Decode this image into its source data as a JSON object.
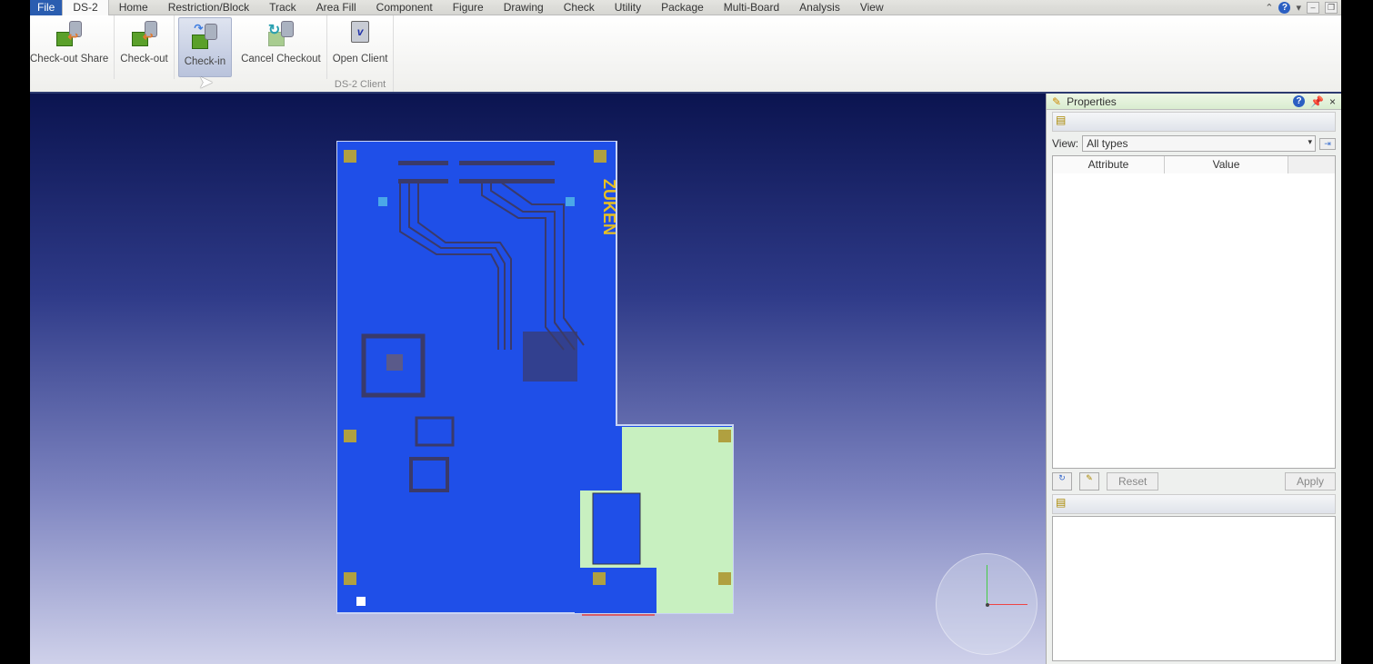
{
  "menu": {
    "items": [
      "File",
      "DS-2",
      "Home",
      "Restriction/Block",
      "Track",
      "Area Fill",
      "Component",
      "Figure",
      "Drawing",
      "Check",
      "Utility",
      "Package",
      "Multi-Board",
      "Analysis",
      "View"
    ],
    "active": "DS-2"
  },
  "ribbon": {
    "buttons": [
      {
        "label": "Check-out Share",
        "icon": "check-out-share-icon"
      },
      {
        "label": "Check-out",
        "icon": "check-out-icon"
      },
      {
        "label": "Check-in",
        "icon": "check-in-icon"
      },
      {
        "label": "Cancel Checkout",
        "icon": "cancel-checkout-icon"
      },
      {
        "label": "Open Client",
        "icon": "open-client-icon"
      }
    ],
    "group_label": "DS-2 Client"
  },
  "board": {
    "logo_text": "ZUKEN",
    "colors": {
      "copper": "#1f4fe8",
      "pad_area": "#c8f0c0",
      "trace": "#3a3a6a"
    }
  },
  "properties": {
    "title": "Properties",
    "view_label": "View:",
    "view_value": "All types",
    "columns": [
      "Attribute",
      "Value"
    ],
    "reset_label": "Reset",
    "apply_label": "Apply"
  },
  "colors": {
    "accent": "#2a5db0",
    "viewport_top": "#0b1450",
    "viewport_bottom": "#cfd1ea"
  }
}
